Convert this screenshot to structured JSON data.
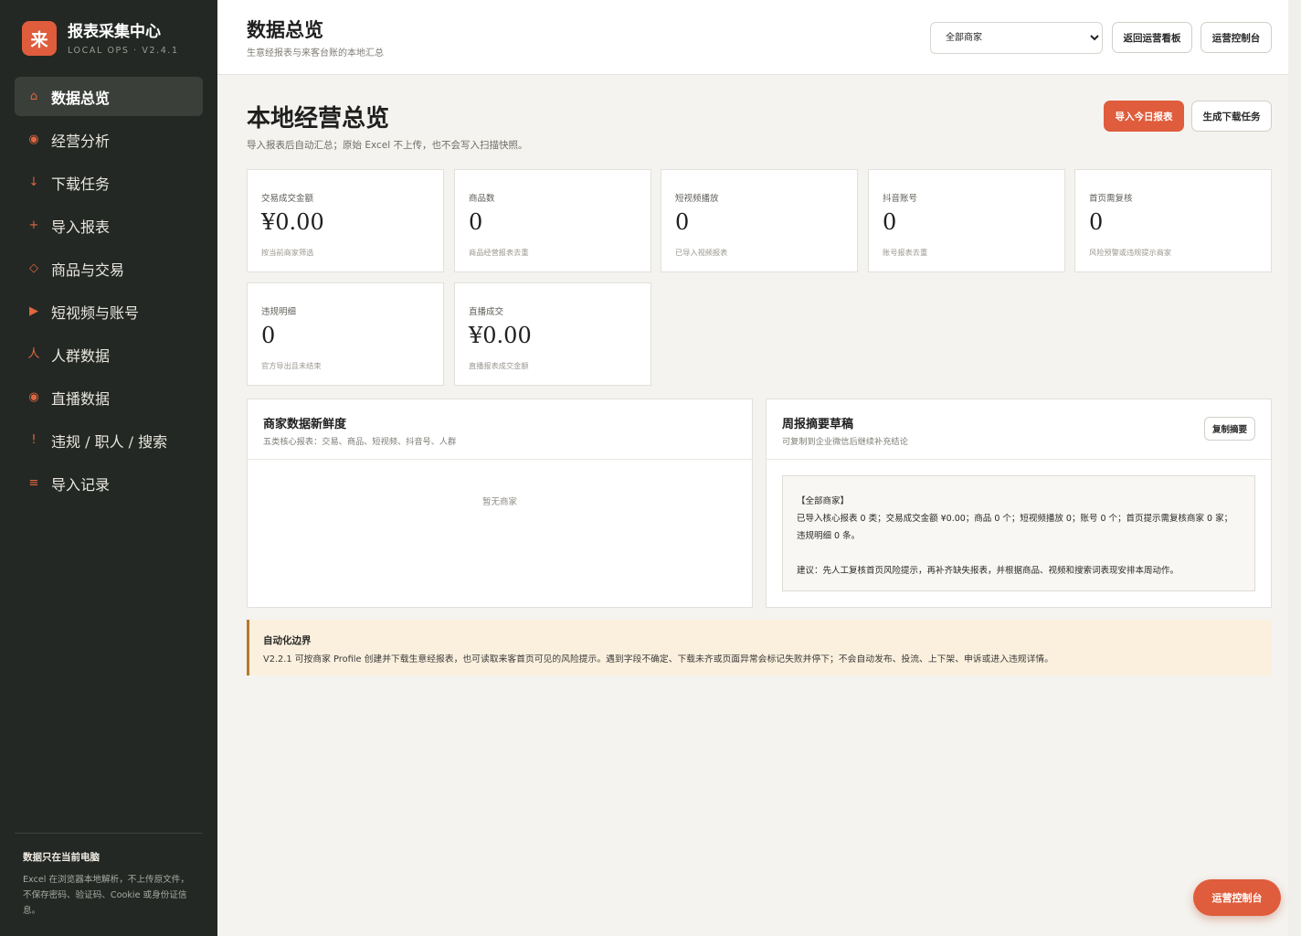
{
  "brand": {
    "logo_char": "来",
    "title": "报表采集中心",
    "version": "LOCAL OPS · V2.4.1"
  },
  "nav": [
    {
      "icon": "⌂",
      "icon_name": "home-icon",
      "label": "数据总览",
      "active": true
    },
    {
      "icon": "◉",
      "icon_name": "analysis-icon",
      "label": "经营分析"
    },
    {
      "icon": "↓",
      "icon_name": "download-icon",
      "label": "下载任务"
    },
    {
      "icon": "+",
      "icon_name": "plus-icon",
      "label": "导入报表"
    },
    {
      "icon": "◇",
      "icon_name": "diamond-icon",
      "label": "商品与交易"
    },
    {
      "icon": "▶",
      "icon_name": "play-icon",
      "label": "短视频与账号"
    },
    {
      "icon": "人",
      "icon_name": "person-icon",
      "label": "人群数据"
    },
    {
      "icon": "◉",
      "icon_name": "live-icon",
      "label": "直播数据"
    },
    {
      "icon": "!",
      "icon_name": "alert-icon",
      "label": "违规 / 职人 / 搜索"
    },
    {
      "icon": "≡",
      "icon_name": "list-icon",
      "label": "导入记录"
    }
  ],
  "side_footer": {
    "title": "数据只在当前电脑",
    "text": "Excel 在浏览器本地解析，不上传原文件，不保存密码、验证码、Cookie 或身份证信息。"
  },
  "header": {
    "title": "数据总览",
    "subtitle": "生意经报表与来客台账的本地汇总",
    "merchant_select": "全部商家",
    "back_button": "返回运营看板",
    "console_button": "运营控制台"
  },
  "overview": {
    "title": "本地经营总览",
    "desc": "导入报表后自动汇总；原始 Excel 不上传，也不会写入扫描快照。",
    "import_button": "导入今日报表",
    "generate_button": "生成下载任务"
  },
  "cards": [
    {
      "label": "交易成交金额",
      "value": "¥0.00",
      "note": "按当前商家筛选"
    },
    {
      "label": "商品数",
      "value": "0",
      "note": "商品经营报表去重"
    },
    {
      "label": "短视频播放",
      "value": "0",
      "note": "已导入视频报表"
    },
    {
      "label": "抖音账号",
      "value": "0",
      "note": "账号报表去重"
    },
    {
      "label": "首页需复核",
      "value": "0",
      "note": "风险预警或违规提示商家"
    },
    {
      "label": "违规明细",
      "value": "0",
      "note": "官方导出且未结束"
    },
    {
      "label": "直播成交",
      "value": "¥0.00",
      "note": "直播报表成交金额"
    }
  ],
  "freshness": {
    "title": "商家数据新鲜度",
    "subtitle": "五类核心报表：交易、商品、短视频、抖音号、人群",
    "empty": "暂无商家"
  },
  "weekly": {
    "title": "周报摘要草稿",
    "subtitle": "可复制到企业微信后继续补充结论",
    "copy_button": "复制摘要",
    "line1": "【全部商家】",
    "line2": "已导入核心报表 0 类；交易成交金额 ¥0.00；商品 0 个；短视频播放 0；账号 0 个；首页提示需复核商家 0 家；违规明细 0 条。",
    "line3": "建议：先人工复核首页风险提示，再补齐缺失报表，并根据商品、视频和搜索词表现安排本周动作。"
  },
  "notice": {
    "title": "自动化边界",
    "text": "V2.2.1 可按商家 Profile 创建并下载生意经报表，也可读取来客首页可见的风险提示。遇到字段不确定、下载未齐或页面异常会标记失败并停下；不会自动发布、投流、上下架、申诉或进入违规详情。"
  },
  "float_button": "运营控制台",
  "colors": {
    "accent": "#df5c3c",
    "sidebar": "#232824",
    "notice_bg": "#fbf0dd"
  }
}
